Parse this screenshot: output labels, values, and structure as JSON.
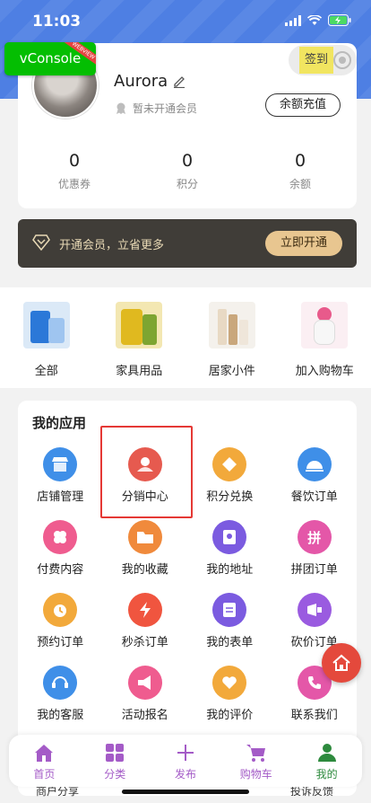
{
  "status_bar": {
    "time": "11:03"
  },
  "vconsole": {
    "label": "vConsole",
    "ribbon": "WEBVIEW"
  },
  "checkin": {
    "label": "签到"
  },
  "profile": {
    "username": "Aurora",
    "member_status": "暂未开通会员",
    "recharge_button": "余额充值",
    "stats": [
      {
        "value": "0",
        "label": "优惠券"
      },
      {
        "value": "0",
        "label": "积分"
      },
      {
        "value": "0",
        "label": "余额"
      }
    ]
  },
  "vip_banner": {
    "text": "开通会员，立省更多",
    "button": "立即开通"
  },
  "categories": [
    {
      "label": "全部",
      "icon": "detergent-product-image"
    },
    {
      "label": "家具用品",
      "icon": "cooking-oil-product-image"
    },
    {
      "label": "居家小件",
      "icon": "cosmetics-product-image"
    },
    {
      "label": "加入购物车",
      "icon": "beauty-device-product-image"
    }
  ],
  "apps": {
    "title": "我的应用",
    "items": [
      {
        "label": "店铺管理",
        "icon": "shop-icon",
        "color": "#3f8fe8"
      },
      {
        "label": "分销中心",
        "icon": "distribution-icon",
        "color": "#e65a4f"
      },
      {
        "label": "积分兑换",
        "icon": "points-exchange-icon",
        "color": "#f2a93b"
      },
      {
        "label": "餐饮订单",
        "icon": "dining-order-icon",
        "color": "#3f8fe8"
      },
      {
        "label": "付费内容",
        "icon": "paid-content-icon",
        "color": "#ef5c8f"
      },
      {
        "label": "我的收藏",
        "icon": "favorites-icon",
        "color": "#f08a3c"
      },
      {
        "label": "我的地址",
        "icon": "address-icon",
        "color": "#7b5be0"
      },
      {
        "label": "拼团订单",
        "icon": "group-buy-icon",
        "color": "#e457a8"
      },
      {
        "label": "预约订单",
        "icon": "reservation-icon",
        "color": "#f2a93b"
      },
      {
        "label": "秒杀订单",
        "icon": "flash-sale-icon",
        "color": "#f0553f"
      },
      {
        "label": "我的表单",
        "icon": "form-icon",
        "color": "#7b5be0"
      },
      {
        "label": "砍价订单",
        "icon": "bargain-icon",
        "color": "#9a5be0"
      },
      {
        "label": "我的客服",
        "icon": "customer-service-icon",
        "color": "#3f8fe8"
      },
      {
        "label": "活动报名",
        "icon": "event-signup-icon",
        "color": "#ef5c8f"
      },
      {
        "label": "我的评价",
        "icon": "review-icon",
        "color": "#f2a93b"
      },
      {
        "label": "联系我们",
        "icon": "contact-icon",
        "color": "#e457a8"
      }
    ],
    "peek_left": "商户分享",
    "peek_right": "投诉反馈"
  },
  "tab_bar": {
    "tabs": [
      {
        "label": "首页",
        "icon": "home-icon"
      },
      {
        "label": "分类",
        "icon": "category-icon"
      },
      {
        "label": "发布",
        "icon": "plus-icon"
      },
      {
        "label": "购物车",
        "icon": "cart-icon"
      },
      {
        "label": "我的",
        "icon": "user-icon",
        "active": true
      }
    ]
  },
  "colors": {
    "header": "#4e7fe3",
    "tab_inactive": "#a45bc7",
    "tab_active": "#2d8a3d",
    "vip_bg": "#403d38",
    "vip_button": "#e8c690"
  }
}
